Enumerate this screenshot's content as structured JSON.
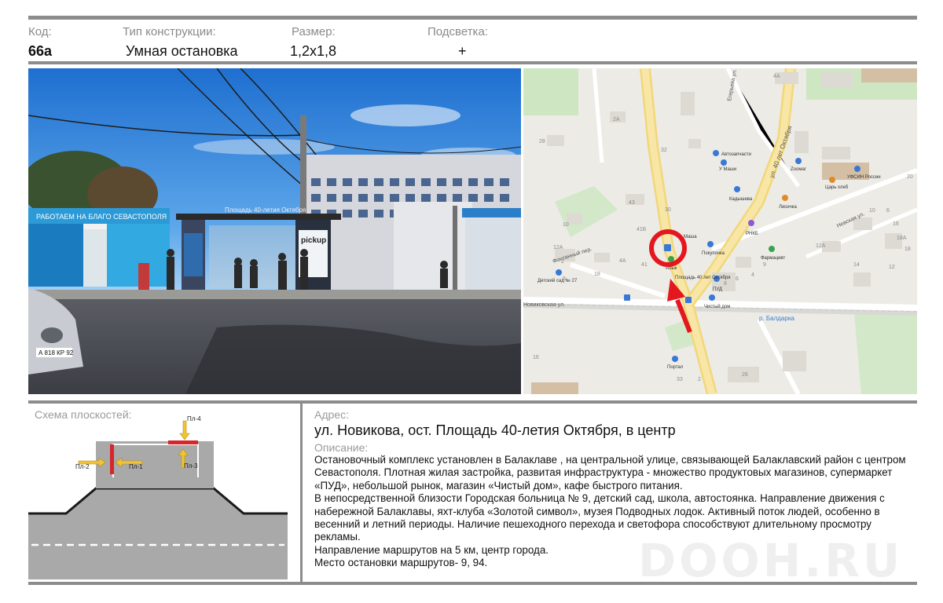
{
  "header": {
    "code_label": "Код:",
    "code_value": "66а",
    "type_label": "Тип конструкции:",
    "type_value": "Умная остановка",
    "size_label": "Размер:",
    "size_value": "1,2х1,8",
    "light_label": "Подсветка:",
    "light_value": "+"
  },
  "photo": {
    "shelter_sign": "Площадь 40-летия Октября",
    "banner_text": "РАБОТАЕМ НА БЛАГО СЕВАСТОПОЛЯ",
    "kiosk_text": "pickup",
    "plate": "А 818 КР 92"
  },
  "map": {
    "streets": {
      "s1": "ул. 40 лет Октября",
      "s2": "Фонтанный пер.",
      "s3": "Новиковская ул.",
      "s4": "р. Балдарка",
      "s5": "Невская ул.",
      "s6": "Егерьева ул."
    },
    "pois": {
      "p1": "Автозапчасти",
      "p2": "У Маши",
      "p3": "Zoомаг",
      "p4": "УФСИН России",
      "p5": "Царь хлеб",
      "p6": "Кадышева",
      "p7": "Лисичка",
      "p8": "РНКБ",
      "p9": "Фармацевт",
      "p10": "Покупочка",
      "p11": "Абык",
      "p12": "ПУД",
      "p13": "Чистый дом",
      "p14": "Детский сад № 27",
      "p15": "Портал",
      "p16": "Площадь 40 лет Октября",
      "p17": "Маша"
    },
    "numbers": [
      "4А",
      "2А",
      "28",
      "32",
      "30",
      "43",
      "41Б",
      "10",
      "12А",
      "4А",
      "41",
      "2",
      "8",
      "6",
      "4",
      "14",
      "12",
      "9",
      "10",
      "6",
      "12А",
      "18А",
      "16",
      "18",
      "20",
      "2",
      "26",
      "33",
      "16",
      "6",
      "18"
    ]
  },
  "scheme": {
    "title": "Схема плоскостей:",
    "pl1": "Пл-1",
    "pl2": "Пл-2",
    "pl3": "Пл-3",
    "pl4": "Пл-4"
  },
  "address": {
    "label": "Адрес:",
    "value": "ул. Новикова, ост. Площадь 40-летия Октября, в центр"
  },
  "description": {
    "label": "Описание:",
    "p1": "Остановочный комплекс установлен в Балаклаве , на  центральной улице, связывающей Балаклавский район с центром Севастополя. Плотная жилая застройка, развитая инфраструктура -  множество  продуктовых магазинов, супермаркет «ПУД», небольшой рынок, магазин «Чистый дом», кафе быстрого питания.",
    "p2": "В непосредственной близости Городская больница № 9, детский сад, школа, автостоянка.  Направление движения с набережной Балаклавы, яхт-клуба «Золотой символ», музея Подводных лодок. Активный поток людей, особенно в весенний и летний периоды.  Наличие пешеходного перехода и светофора способствуют длительному просмотру рекламы.",
    "p3": "Направление маршрутов на 5 км, центр города.",
    "p4": "Место остановки маршрутов- 9, 94."
  },
  "watermark": "DOOH.RU"
}
